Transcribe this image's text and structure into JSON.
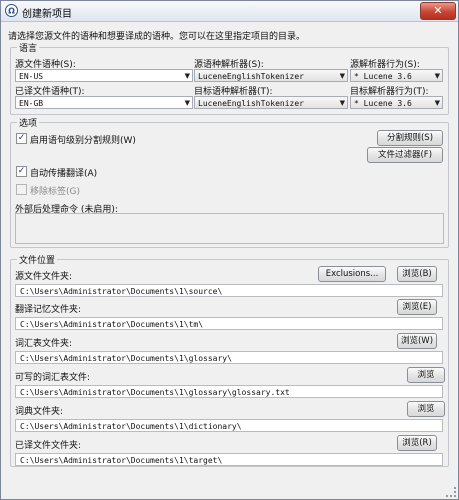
{
  "window": {
    "title": "创建新项目",
    "close_label": "✕"
  },
  "hint": "请选择您源文件的语种和想要译成的语种。您可以在这里指定项目的目录。",
  "language": {
    "legend": "语言",
    "source_lang_label": "源文件语种(S):",
    "source_lang_value": "EN-US",
    "source_tokenizer_label": "源语种解析器(S):",
    "source_tokenizer_value": "LuceneEnglishTokenizer",
    "source_behavior_label": "源解析器行为(S):",
    "source_behavior_value": "* Lucene 3.6",
    "target_lang_label": "已译文件语种(T):",
    "target_lang_value": "EN-GB",
    "target_tokenizer_label": "目标语种解析器(T):",
    "target_tokenizer_value": "LuceneEnglishTokenizer",
    "target_behavior_label": "目标解析器行为(T):",
    "target_behavior_value": "* Lucene 3.6",
    "arrow": "▼"
  },
  "options": {
    "legend": "选项",
    "segmentation_label": "启用语句级别分割规则(W)",
    "segmentation_checked": true,
    "segmentation_button": "分割规则(S)",
    "file_filters_button": "文件过滤器(F)",
    "auto_propagate_label": "自动传播翻译(A)",
    "auto_propagate_checked": true,
    "remove_tags_label": "移除标签(G)",
    "remove_tags_checked": false,
    "external_cmd_label": "外部后处理命令 (未启用):",
    "check_mark": "✓"
  },
  "locations": {
    "legend": "文件位置",
    "source_label": "源文件文件夹:",
    "exclusions_button": "Exclusions...",
    "source_browse": "浏览(B)",
    "source_path": "C:\\Users\\Administrator\\Documents\\1\\source\\",
    "tm_label": "翻译记忆文件夹:",
    "tm_browse": "浏览(E)",
    "tm_path": "C:\\Users\\Administrator\\Documents\\1\\tm\\",
    "glossary_label": "词汇表文件夹:",
    "glossary_browse": "浏览(W)",
    "glossary_path": "C:\\Users\\Administrator\\Documents\\1\\glossary\\",
    "writable_glossary_label": "可写的词汇表文件:",
    "writable_glossary_browse": "浏览",
    "writable_glossary_path": "C:\\Users\\Administrator\\Documents\\1\\glossary\\glossary.txt",
    "dictionary_label": "词典文件夹:",
    "dictionary_browse": "浏览",
    "dictionary_path": "C:\\Users\\Administrator\\Documents\\1\\dictionary\\",
    "target_label": "已译文件文件夹:",
    "target_browse": "浏览(R)",
    "target_path": "C:\\Users\\Administrator\\Documents\\1\\target\\"
  }
}
